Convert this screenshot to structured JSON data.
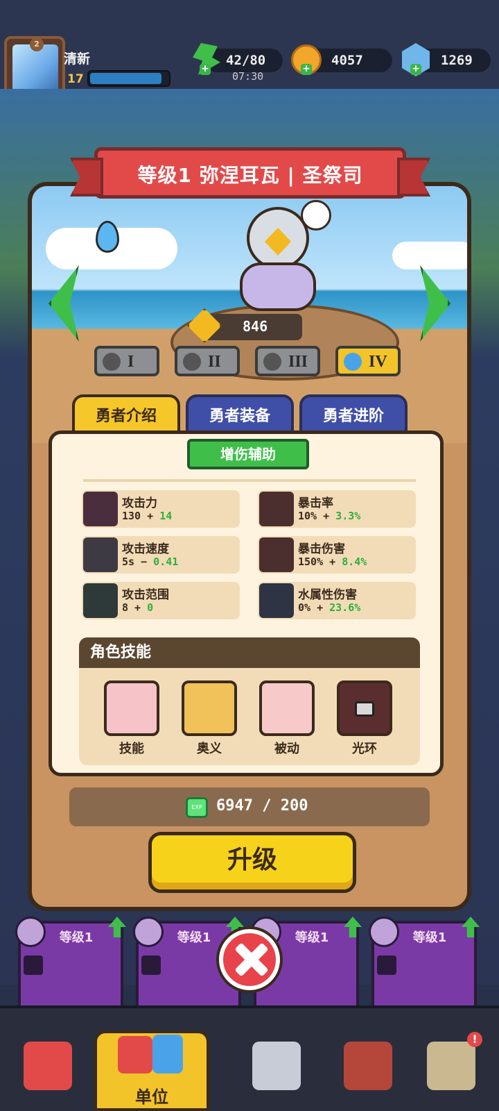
{
  "player": {
    "name": "清新",
    "level": "17",
    "xp_fraction": 0.92,
    "avatar_badge": "2"
  },
  "resources": {
    "energy": "42/80",
    "energy_timer": "07:30",
    "gold": "4057",
    "gems": "1269"
  },
  "hero": {
    "title": "等级1 弥涅耳瓦 | 圣祭司",
    "power": "846",
    "element": "water-drop-icon"
  },
  "tiers": [
    {
      "label": "I",
      "active": false
    },
    {
      "label": "II",
      "active": false
    },
    {
      "label": "III",
      "active": false
    },
    {
      "label": "IV",
      "active": true
    }
  ],
  "tabs": {
    "intro": "勇者介绍",
    "equip": "勇者装备",
    "advance": "勇者进阶"
  },
  "role": "增伤辅助",
  "stats": [
    {
      "name": "攻击力",
      "base": "130 +",
      "bonus": "14",
      "icon": "attack-icon"
    },
    {
      "name": "暴击率",
      "base": "10% +",
      "bonus": "3.3%",
      "icon": "crit-rate-icon"
    },
    {
      "name": "攻击速度",
      "base": "5s −",
      "bonus": "0.41",
      "icon": "attack-speed-icon"
    },
    {
      "name": "暴击伤害",
      "base": "150% +",
      "bonus": "8.4%",
      "icon": "crit-damage-icon"
    },
    {
      "name": "攻击范围",
      "base": "8 +",
      "bonus": "0",
      "icon": "attack-range-icon"
    },
    {
      "name": "水属性伤害",
      "base": "0% +",
      "bonus": "23.6%",
      "icon": "water-damage-icon"
    }
  ],
  "skills_title": "角色技能",
  "skills": [
    {
      "label": "技能",
      "icon": "skill-icon",
      "color": "#f6c3c8"
    },
    {
      "label": "奥义",
      "icon": "ultimate-icon",
      "color": "#f2c25a"
    },
    {
      "label": "被动",
      "icon": "passive-icon",
      "color": "#f7c9c9"
    },
    {
      "label": "光环",
      "icon": "aura-locked-icon",
      "color": "#5a2e2e"
    }
  ],
  "exp": {
    "value": "6947 / 200",
    "icon_text": "EXP"
  },
  "upgrade_label": "升级",
  "unit_cards": [
    {
      "level": "等级1"
    },
    {
      "level": "等级1"
    },
    {
      "level": "等级1"
    },
    {
      "level": "等级1"
    }
  ],
  "bottom_nav": {
    "units": "单位"
  },
  "colors": {
    "accent": "#f6c72a",
    "bonus": "#2fae3c",
    "title_banner": "#e24a4a",
    "tab_inactive": "#3f4fa8"
  }
}
